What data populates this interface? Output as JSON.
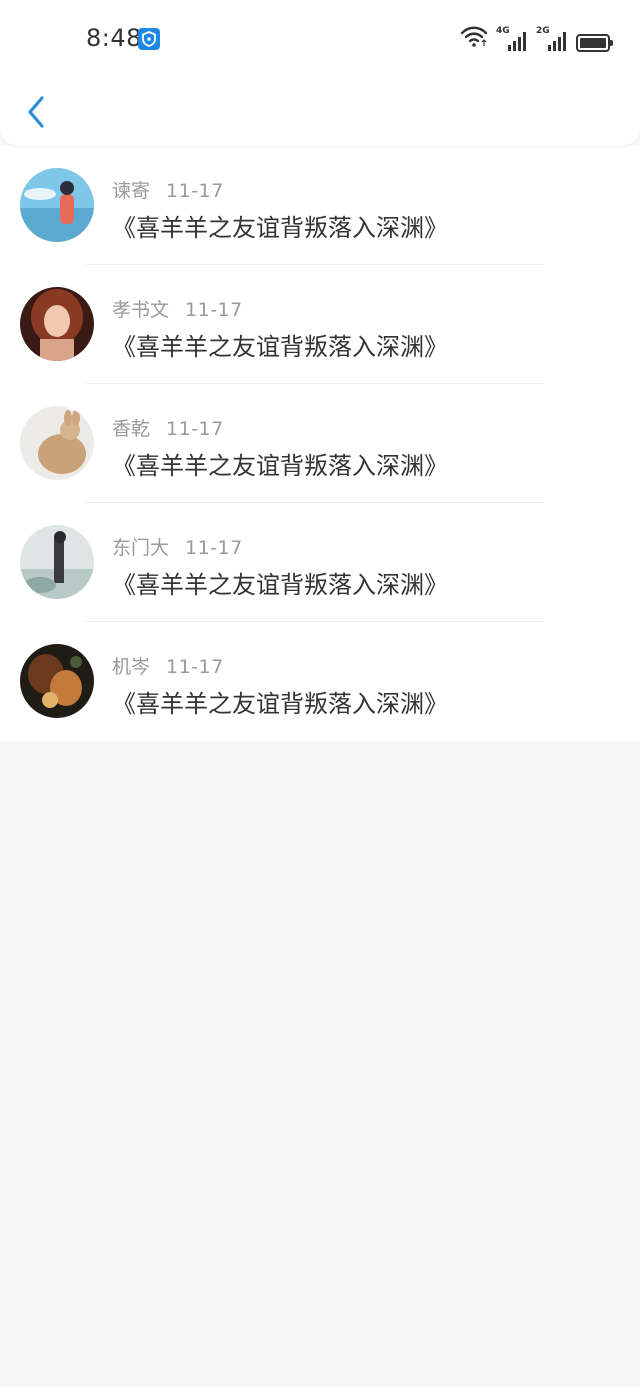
{
  "status_bar": {
    "time": "8:48",
    "network_1": "4G",
    "network_2": "2G"
  },
  "header": {
    "back_icon": "chevron-left-icon",
    "accent_color": "#2b8fd6"
  },
  "list": {
    "items": [
      {
        "name": "谏寄",
        "date": "11-17",
        "title": "《喜羊羊之友谊背叛落入深渊》"
      },
      {
        "name": "孝书文",
        "date": "11-17",
        "title": "《喜羊羊之友谊背叛落入深渊》"
      },
      {
        "name": "香乾",
        "date": "11-17",
        "title": "《喜羊羊之友谊背叛落入深渊》"
      },
      {
        "name": "东门大",
        "date": "11-17",
        "title": "《喜羊羊之友谊背叛落入深渊》"
      },
      {
        "name": "机岑",
        "date": "11-17",
        "title": "《喜羊羊之友谊背叛落入深渊》"
      }
    ]
  }
}
